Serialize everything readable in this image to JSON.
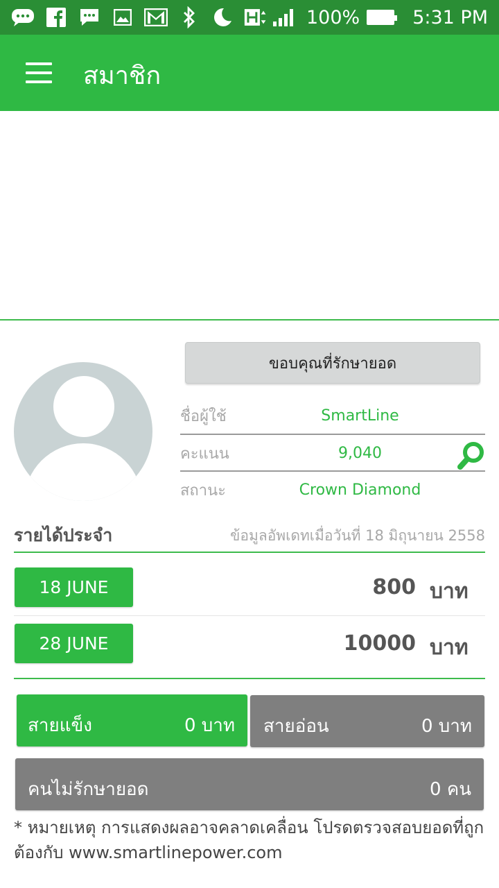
{
  "status_bar": {
    "battery": "100%",
    "time": "5:31 PM",
    "icons": [
      "chat-bubble-icon",
      "facebook-icon",
      "message-icon",
      "image-icon",
      "gmail-icon",
      "bluetooth-icon",
      "moon-icon",
      "h-network-icon",
      "signal-icon",
      "battery-icon"
    ]
  },
  "appbar": {
    "title": "สมาชิก",
    "color": "#2fb944"
  },
  "profile": {
    "thanks_button": "ขอบคุณที่รักษายอด",
    "rows": [
      {
        "label": "ชื่อผู้ใช้",
        "value": "SmartLine"
      },
      {
        "label": "คะแนน",
        "value": "9,040"
      },
      {
        "label": "สถานะ",
        "value": "Crown Diamond"
      }
    ]
  },
  "income": {
    "title": "รายได้ประจำ",
    "update_note": "ข้อมูลอัพเดทเมื่อวันที่  18 มิถุนายน 2558",
    "entries": [
      {
        "date": "18 JUNE",
        "amount": "800",
        "unit": "บาท"
      },
      {
        "date": "28 JUNE",
        "amount": "10000",
        "unit": "บาท"
      }
    ]
  },
  "summary": {
    "strong": {
      "label": "สายแข็ง",
      "value": "0 บาท"
    },
    "weak": {
      "label": "สายอ่อน",
      "value": "0 บาท"
    },
    "inactive": {
      "label": "คนไม่รักษายอด",
      "value": "0 คน"
    }
  },
  "footnote": "* หมายเหตุ การแสดงผลอาจคลาดเคลื่อน โปรดตรวจสอบยอดที่ถูกต้องกับ www.smartlinepower.com"
}
